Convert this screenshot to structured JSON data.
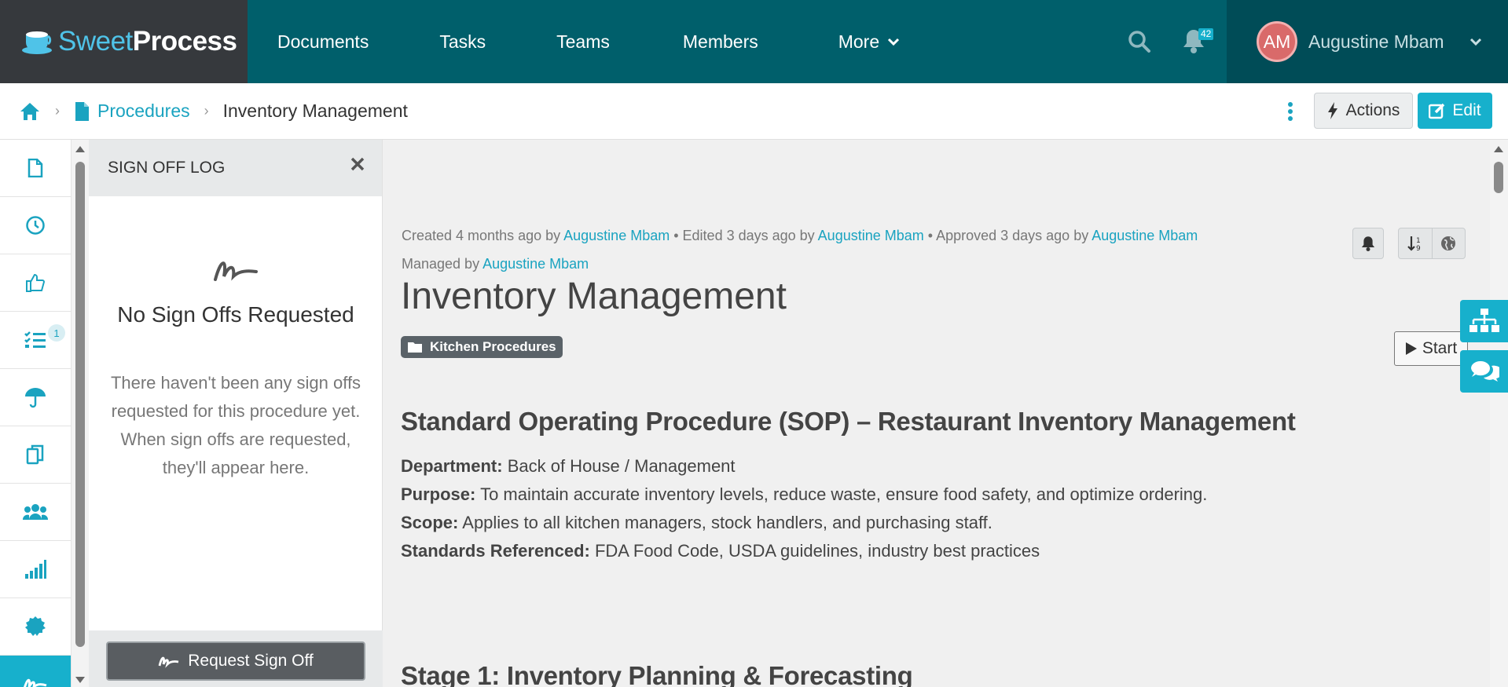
{
  "brand": {
    "logo_light": "Sweet",
    "logo_bold": "Process"
  },
  "nav": {
    "items": [
      "Documents",
      "Tasks",
      "Teams",
      "Members",
      "More"
    ],
    "notification_count": "42"
  },
  "user": {
    "initials": "AM",
    "name": "Augustine Mbam"
  },
  "breadcrumb": {
    "section": "Procedures",
    "current": "Inventory Management"
  },
  "toolbar": {
    "actions_label": "Actions",
    "edit_label": "Edit"
  },
  "sidebar": {
    "badge_count": "1"
  },
  "signoff": {
    "title": "SIGN OFF LOG",
    "empty_title": "No Sign Offs Requested",
    "empty_desc": "There haven't been any sign offs requested for this procedure yet. When sign offs are requested, they'll appear here.",
    "request_label": "Request Sign Off"
  },
  "doc": {
    "meta": {
      "created_prefix": "Created 4 months ago by",
      "created_by": "Augustine Mbam",
      "edited_prefix": "• Edited 3 days ago by",
      "edited_by": "Augustine Mbam",
      "approved_prefix": "• Approved 3 days ago by",
      "approved_by": "Augustine Mbam",
      "managed_prefix": "Managed by",
      "managed_by": "Augustine Mbam"
    },
    "title": "Inventory Management",
    "tag": "Kitchen Procedures",
    "start_label": "Start",
    "heading": "Standard Operating Procedure (SOP) – Restaurant Inventory Management",
    "fields": [
      {
        "label": "Department:",
        "value": "Back of House / Management"
      },
      {
        "label": "Purpose:",
        "value": "To maintain accurate inventory levels, reduce waste, ensure food safety, and optimize ordering."
      },
      {
        "label": "Scope:",
        "value": "Applies to all kitchen managers, stock handlers, and purchasing staff."
      },
      {
        "label": "Standards Referenced:",
        "value": "FDA Food Code, USDA guidelines, industry best practices"
      }
    ],
    "stage1": "Stage 1: Inventory Planning & Forecasting"
  },
  "colors": {
    "primary": "#005f6b",
    "accent": "#17b0cc",
    "logo_bg": "#36393d"
  }
}
